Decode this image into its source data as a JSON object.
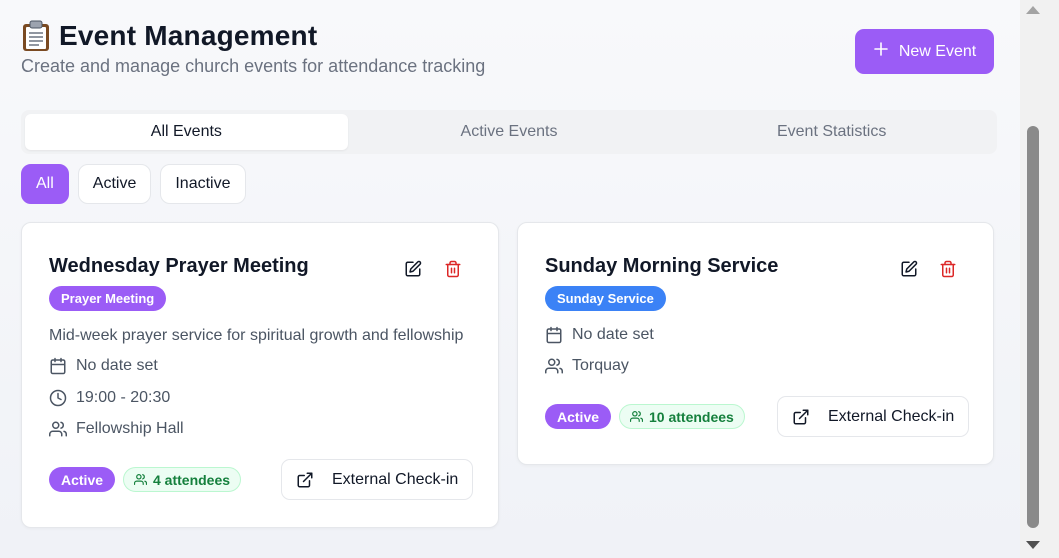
{
  "header": {
    "title": "Event Management",
    "subtitle": "Create and manage church events for attendance tracking",
    "new_button": "New Event"
  },
  "tabs": [
    {
      "label": "All Events",
      "active": true
    },
    {
      "label": "Active Events",
      "active": false
    },
    {
      "label": "Event Statistics",
      "active": false
    }
  ],
  "filters": [
    {
      "label": "All",
      "active": true
    },
    {
      "label": "Active",
      "active": false
    },
    {
      "label": "Inactive",
      "active": false
    }
  ],
  "events": [
    {
      "title": "Wednesday Prayer Meeting",
      "type": "Prayer Meeting",
      "type_color": "#9b5cf6",
      "description": "Mid-week prayer service for spiritual growth and fellowship",
      "date": "No date set",
      "time": "19:00 - 20:30",
      "location": "Fellowship Hall",
      "status": "Active",
      "attendees": "4 attendees",
      "checkin_label": "External Check-in"
    },
    {
      "title": "Sunday Morning Service",
      "type": "Sunday Service",
      "type_color": "#3b82f6",
      "date": "No date set",
      "location": "Torquay",
      "status": "Active",
      "attendees": "10 attendees",
      "checkin_label": "External Check-in"
    }
  ],
  "colors": {
    "accent": "#9b5cf6",
    "delete": "#dc2626",
    "attendee_green": "#15803d"
  }
}
